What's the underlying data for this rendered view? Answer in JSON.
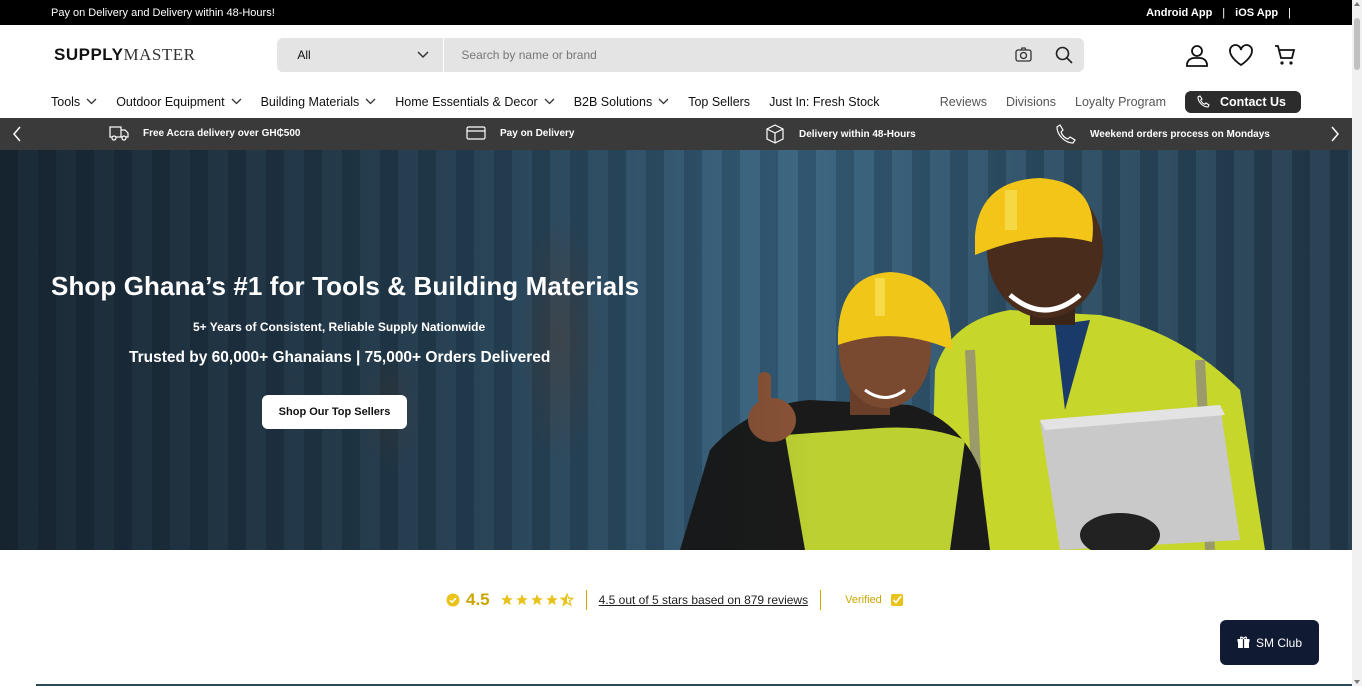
{
  "announcement": {
    "text": "Pay on Delivery and Delivery within 48-Hours!",
    "android_app": "Android App",
    "ios_app": "iOS App",
    "separator": "|"
  },
  "header": {
    "logo_bold": "SUPPLY",
    "logo_thin": "MASTER",
    "search": {
      "category": "All",
      "placeholder": "Search by name or brand"
    }
  },
  "nav": {
    "items": [
      {
        "label": "Tools",
        "dropdown": true
      },
      {
        "label": "Outdoor Equipment",
        "dropdown": true
      },
      {
        "label": "Building Materials",
        "dropdown": true
      },
      {
        "label": "Home Essentials & Decor",
        "dropdown": true
      },
      {
        "label": "B2B Solutions",
        "dropdown": true
      },
      {
        "label": "Top Sellers",
        "dropdown": false
      },
      {
        "label": "Just In: Fresh Stock",
        "dropdown": false
      }
    ],
    "right_links": [
      "Reviews",
      "Divisions",
      "Loyalty Program"
    ],
    "contact_label": "Contact Us"
  },
  "strip": {
    "items": [
      {
        "icon": "truck-icon",
        "text": "Free Accra delivery over GH₵500"
      },
      {
        "icon": "card-icon",
        "text": "Pay on Delivery"
      },
      {
        "icon": "box-icon",
        "text": "Delivery within 48-Hours"
      },
      {
        "icon": "phone-icon",
        "text": "Weekend orders process on Mondays"
      }
    ]
  },
  "hero": {
    "title": "Shop Ghana’s #1 for Tools & Building Materials",
    "subtitle": "5+ Years of Consistent, Reliable Supply Nationwide",
    "trust": "Trusted by 60,000+ Ghanaians | 75,000+ Orders Delivered",
    "cta": "Shop Our Top Sellers"
  },
  "reviews": {
    "score": "4.5",
    "rating_out_of_5": 4.5,
    "summary": "4.5 out of 5 stars based on 879 reviews",
    "verified": "Verified"
  },
  "sm_club": {
    "label": "SM Club"
  },
  "colors": {
    "accent_gold": "#c9a600",
    "dark": "#2c2c2c",
    "club_bg": "#111a33"
  }
}
